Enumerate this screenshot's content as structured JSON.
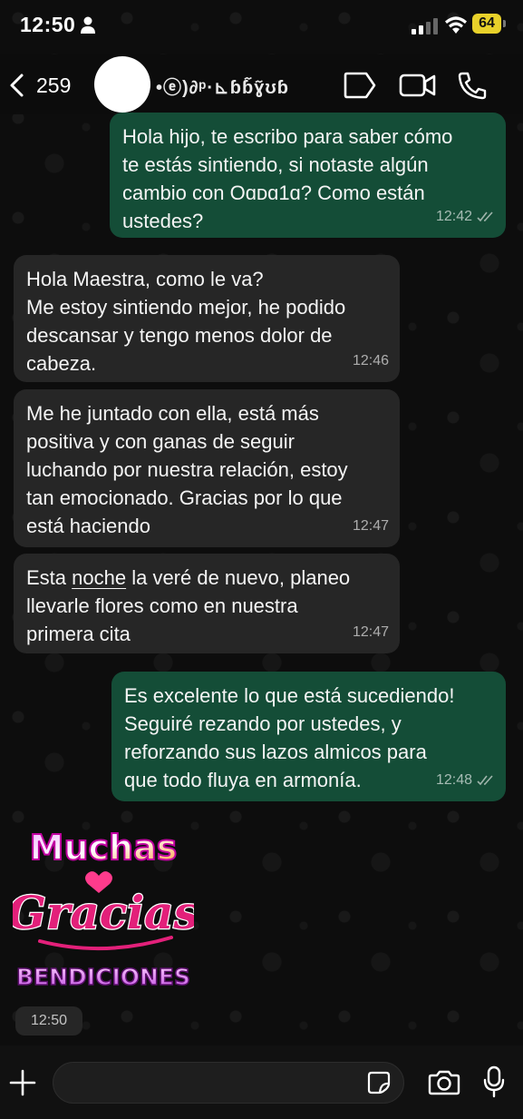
{
  "status_bar": {
    "time": "12:50",
    "battery": "64"
  },
  "header": {
    "back_count": "259",
    "contact_name": "•ⓔ)∂ᵖ·⊾ɓɓ᷉ɣ᷉ʊɓ"
  },
  "messages": [
    {
      "direction": "outgoing",
      "text": "Hola hijo, te escribo para saber cómo\nte estás sintiendo, si notaste algún\ncambio con Oɑᴅɑ1ɑ? Como están\nustedes?",
      "time": "12:42"
    },
    {
      "direction": "incoming",
      "text": "Hola Maestra, como le va?\nMe estoy sintiendo mejor, he podido\ndescansar y tengo menos dolor de\ncabeza.",
      "time": "12:46"
    },
    {
      "direction": "incoming",
      "text": "Me he juntado con ella, está más\npositiva y con ganas de seguir\nluchando por nuestra relación, estoy\ntan emocionado. Gracias por lo que\nestá haciendo",
      "time": "12:47"
    },
    {
      "direction": "incoming",
      "text_before": "Esta ",
      "text_link": "noche",
      "text_after": " la veré de nuevo, planeo\nllevarle flores como en nuestra\nprimera cita",
      "time": "12:47"
    },
    {
      "direction": "outgoing",
      "text": "Es excelente lo que está sucediendo!\nSeguiré rezando por ustedes, y\nreforzando sus lazos almicos para\nque todo fluya en armonía.",
      "time": "12:48"
    }
  ],
  "sticker": {
    "line1": "Muchas",
    "line2": "Gracias",
    "line3": "BENDICIONES",
    "time": "12:50"
  },
  "input": {
    "placeholder": ""
  },
  "colors": {
    "outgoing_bubble": "#144d37",
    "incoming_bubble": "#262626",
    "battery": "#e8d12a",
    "read_ticks": "#9fb4ab"
  },
  "icons": [
    "person-icon",
    "signal-icon",
    "wifi-icon",
    "back-chevron-icon",
    "tag-icon",
    "video-camera-icon",
    "phone-icon",
    "double-check-icon",
    "plus-icon",
    "sticker-icon",
    "camera-icon",
    "microphone-icon"
  ]
}
